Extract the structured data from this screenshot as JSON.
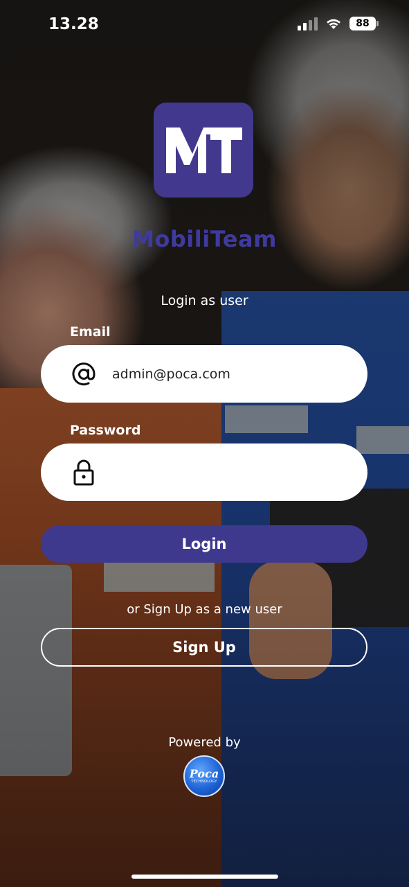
{
  "status_bar": {
    "time": "13.28",
    "battery": "88"
  },
  "app": {
    "logo_text": "MT",
    "name": "MobiliTeam",
    "brand_color": "#42398e"
  },
  "login_form": {
    "subtitle": "Login as user",
    "email_label": "Email",
    "email_value": "admin@poca.com",
    "email_icon": "at-sign-icon",
    "password_label": "Password",
    "password_value": "",
    "password_icon": "lock-icon",
    "login_button": "Login"
  },
  "signup": {
    "prompt": "or Sign Up as a new user",
    "button": "Sign Up"
  },
  "footer": {
    "powered_by": "Powered by",
    "company_logo_text": "Poca",
    "company_logo_subtext": "TECHNOLOGY"
  }
}
